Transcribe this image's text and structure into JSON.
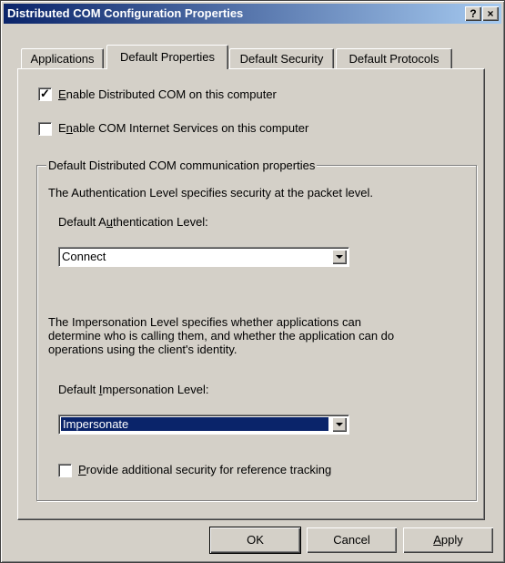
{
  "window": {
    "title": "Distributed COM Configuration Properties",
    "help_button": "?",
    "close_button": "×"
  },
  "tabs": [
    {
      "label": "Applications",
      "active": false
    },
    {
      "label": "Default Properties",
      "active": true
    },
    {
      "label": "Default Security",
      "active": false
    },
    {
      "label": "Default Protocols",
      "active": false
    }
  ],
  "options": {
    "enable_dcom": {
      "pre": "",
      "accel": "E",
      "post": "nable Distributed COM on this computer",
      "checked": true
    },
    "enable_cis": {
      "pre": "E",
      "accel": "n",
      "post": "able COM Internet Services on this computer",
      "checked": false
    }
  },
  "group": {
    "title": "Default Distributed COM communication properties",
    "auth_desc": "The Authentication Level specifies security at the packet level.",
    "auth_label": {
      "pre": "Default A",
      "accel": "u",
      "post": "thentication Level:"
    },
    "auth_value": "Connect",
    "imp_desc_lines": [
      "The Impersonation Level specifies whether applications can",
      "determine who is calling them, and whether the application can do",
      "operations using the client's identity."
    ],
    "imp_label": {
      "pre": "Default ",
      "accel": "I",
      "post": "mpersonation Level:"
    },
    "imp_value": "Impersonate",
    "ref_tracking": {
      "pre": "",
      "accel": "P",
      "post": "rovide additional security for reference tracking",
      "checked": false
    }
  },
  "buttons": {
    "ok": "OK",
    "cancel": "Cancel",
    "apply": {
      "pre": "",
      "accel": "A",
      "post": "pply"
    }
  },
  "colors": {
    "title_start": "#0a246a",
    "title_end": "#a6caf0",
    "face": "#d4d0c8",
    "selection": "#0a246a"
  }
}
